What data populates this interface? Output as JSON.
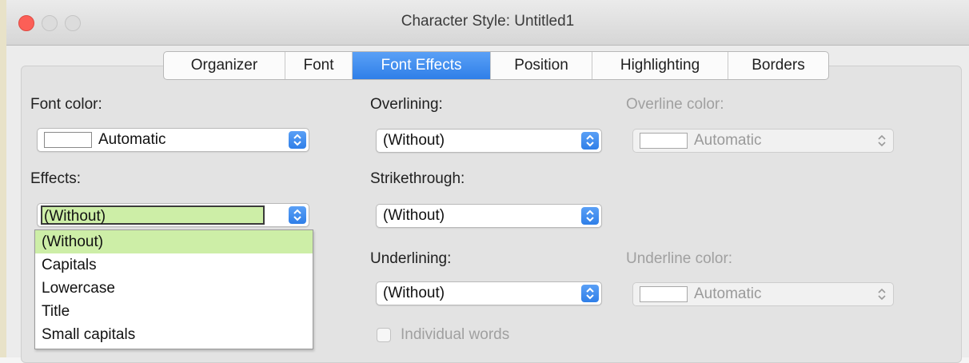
{
  "window": {
    "title": "Character Style: Untitled1"
  },
  "tabs": [
    {
      "label": "Organizer"
    },
    {
      "label": "Font"
    },
    {
      "label": "Font Effects",
      "active": true
    },
    {
      "label": "Position"
    },
    {
      "label": "Highlighting"
    },
    {
      "label": "Borders"
    }
  ],
  "font_color": {
    "label": "Font color:",
    "value": "Automatic"
  },
  "effects": {
    "label": "Effects:",
    "value": "(Without)",
    "options": [
      "(Without)",
      "Capitals",
      "Lowercase",
      "Title",
      "Small capitals"
    ],
    "selected_index": 0
  },
  "overlining": {
    "label": "Overlining:",
    "value": "(Without)"
  },
  "overline_color": {
    "label": "Overline color:",
    "value": "Automatic"
  },
  "strikethrough": {
    "label": "Strikethrough:",
    "value": "(Without)"
  },
  "underlining": {
    "label": "Underlining:",
    "value": "(Without)"
  },
  "underline_color": {
    "label": "Underline color:",
    "value": "Automatic"
  },
  "individual_words": {
    "label": "Individual words",
    "checked": false
  },
  "colors": {
    "accent": "#3d8cf0",
    "selection_highlight": "#cdeea7",
    "close_button": "#fc5f57"
  }
}
